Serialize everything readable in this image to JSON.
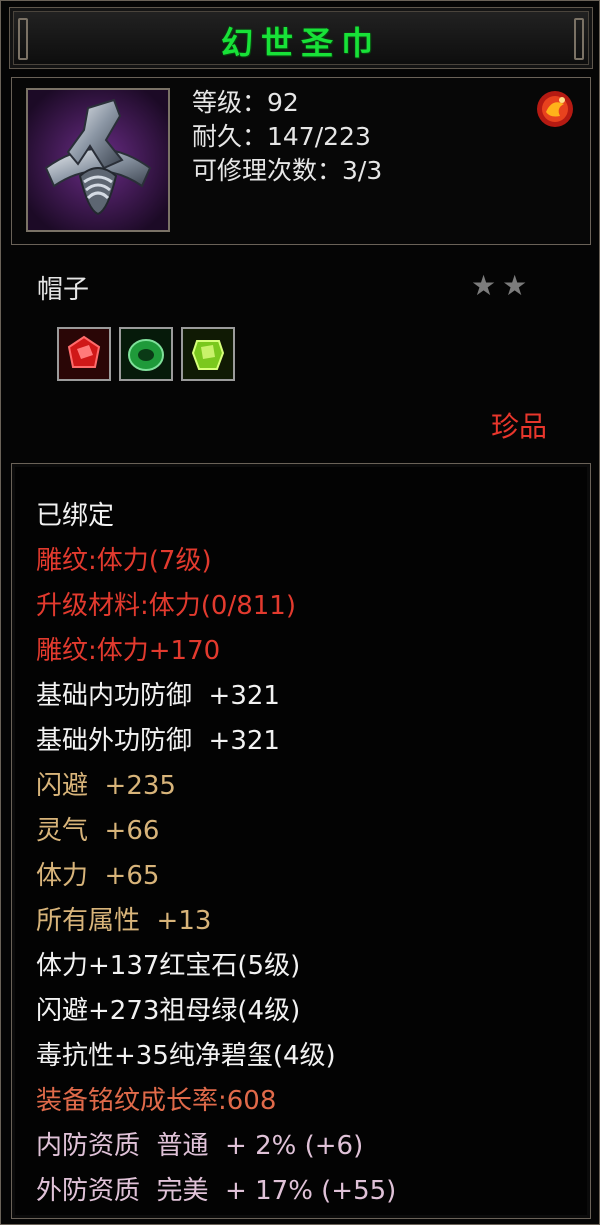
{
  "item": {
    "name": "幻世圣巾",
    "level_line": "等级：92",
    "durability_line": "耐久：147/223",
    "repair_line": "可修理次数：3/3",
    "type": "帽子",
    "stars": "★★",
    "rarity": "珍品"
  },
  "icons": {
    "item_icon": "helmet-icon",
    "badge_icon": "gem-badge-icon",
    "gems": [
      "ruby-gem-icon",
      "emerald-gem-icon",
      "jade-gem-icon"
    ]
  },
  "attributes": [
    {
      "text": "已绑定",
      "color": "#f2f2f2"
    },
    {
      "text": "雕纹:体力(7级)",
      "color": "#e23a2e"
    },
    {
      "text": "升级材料:体力(0/811)",
      "color": "#e23a2e"
    },
    {
      "text": "雕纹:体力+170",
      "color": "#e23a2e"
    },
    {
      "text": "基础内功防御  +321",
      "color": "#f2f2f2"
    },
    {
      "text": "基础外功防御  +321",
      "color": "#f2f2f2"
    },
    {
      "text": "闪避  +235",
      "color": "#d8b47a"
    },
    {
      "text": "灵气  +66",
      "color": "#d8b47a"
    },
    {
      "text": "体力  +65",
      "color": "#d8b47a"
    },
    {
      "text": "所有属性  +13",
      "color": "#d8b47a"
    },
    {
      "text": "体力+137红宝石(5级)",
      "color": "#f2f2f2"
    },
    {
      "text": "闪避+273祖母绿(4级)",
      "color": "#f2f2f2"
    },
    {
      "text": "毒抗性+35纯净碧玺(4级)",
      "color": "#f2f2f2"
    },
    {
      "text": "装备铭纹成长率:608",
      "color": "#e06a4a"
    },
    {
      "text": "内防资质  普通  + 2% (+6)",
      "color": "#e0c2d8"
    },
    {
      "text": "外防资质  完美  + 17% (+55)",
      "color": "#e0c2d8"
    }
  ]
}
